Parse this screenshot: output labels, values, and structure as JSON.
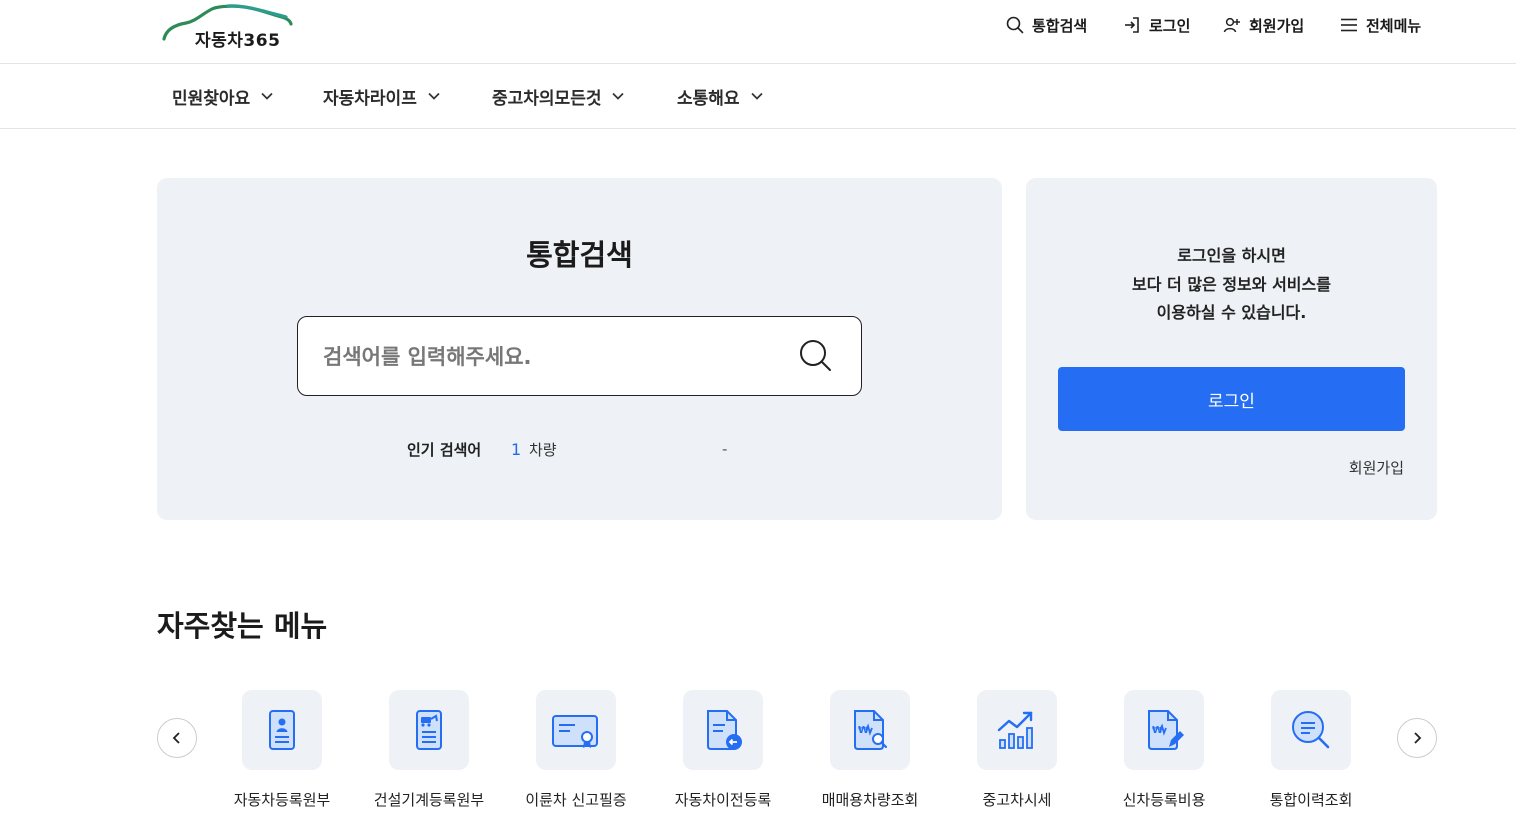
{
  "header": {
    "logo_text": "자동차365",
    "util_links": [
      {
        "label": "통합검색",
        "icon": "search-icon"
      },
      {
        "label": "로그인",
        "icon": "login-icon"
      },
      {
        "label": "회원가입",
        "icon": "user-plus-icon"
      },
      {
        "label": "전체메뉴",
        "icon": "hamburger-icon"
      }
    ]
  },
  "gnb": {
    "items": [
      {
        "label": "민원찾아요"
      },
      {
        "label": "자동차라이프"
      },
      {
        "label": "중고차의모든것"
      },
      {
        "label": "소통해요"
      }
    ]
  },
  "search": {
    "title": "통합검색",
    "placeholder": "검색어를 입력해주세요.",
    "popular_label": "인기 검색어",
    "popular_rank": "1",
    "popular_word": "차량",
    "popular_dash": "-"
  },
  "login": {
    "message_line1": "로그인을 하시면",
    "message_line2": "보다 더 많은 정보와 서비스를",
    "message_line3": "이용하실 수 있습니다.",
    "button_label": "로그인",
    "join_label": "회원가입"
  },
  "frequent": {
    "title": "자주찾는 메뉴",
    "items": [
      {
        "label": "자동차등록원부",
        "icon": "registration-document-icon"
      },
      {
        "label": "건설기계등록원부",
        "icon": "construction-machine-document-icon"
      },
      {
        "label": "이륜차 신고필증",
        "icon": "certificate-card-icon"
      },
      {
        "label": "자동차이전등록",
        "icon": "transfer-document-icon"
      },
      {
        "label": "매매용차량조회",
        "icon": "document-search-icon"
      },
      {
        "label": "중고차시세",
        "icon": "chart-up-icon"
      },
      {
        "label": "신차등록비용",
        "icon": "document-pen-icon"
      },
      {
        "label": "통합이력조회",
        "icon": "history-search-icon"
      }
    ]
  },
  "colors": {
    "primary": "#256ef4",
    "panel_bg": "#eef1f5",
    "logo_green": "#2e8b57",
    "logo_teal": "#2a8a8a"
  }
}
